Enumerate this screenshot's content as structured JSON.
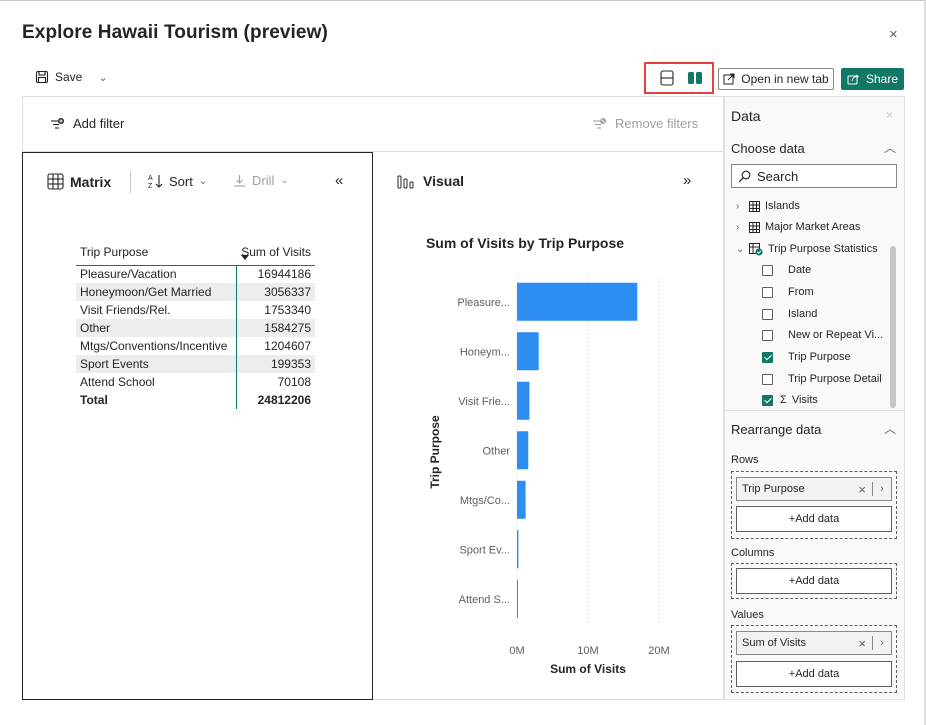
{
  "dialog": {
    "title": "Explore Hawaii Tourism (preview)",
    "close_glyph": "×"
  },
  "toolbar": {
    "save_label": "Save",
    "open_new_tab_label": "Open in new tab",
    "share_label": "Share"
  },
  "filters": {
    "add_filter_label": "Add filter",
    "remove_filters_label": "Remove filters"
  },
  "matrix": {
    "title": "Matrix",
    "sort_label": "Sort",
    "drill_label": "Drill",
    "columns": [
      "Trip Purpose",
      "Sum of Visits"
    ],
    "rows": [
      {
        "label": "Pleasure/Vacation",
        "value": "16944186"
      },
      {
        "label": "Honeymoon/Get Married",
        "value": "3056337"
      },
      {
        "label": "Visit Friends/Rel.",
        "value": "1753340"
      },
      {
        "label": "Other",
        "value": "1584275"
      },
      {
        "label": "Mtgs/Conventions/Incentive",
        "value": "1204607"
      },
      {
        "label": "Sport Events",
        "value": "199353"
      },
      {
        "label": "Attend School",
        "value": "70108"
      }
    ],
    "total": {
      "label": "Total",
      "value": "24812206"
    }
  },
  "visual": {
    "title": "Visual"
  },
  "chart_data": {
    "type": "bar",
    "orientation": "horizontal",
    "title": "Sum of Visits by Trip Purpose",
    "xlabel": "Sum of Visits",
    "ylabel": "Trip Purpose",
    "categories": [
      "Pleasure...",
      "Honeym...",
      "Visit Frie...",
      "Other",
      "Mtgs/Co...",
      "Sport Ev...",
      "Attend S..."
    ],
    "values": [
      16944186,
      3056337,
      1753340,
      1584275,
      1204607,
      199353,
      70108
    ],
    "x_ticks": [
      "0M",
      "10M",
      "20M"
    ],
    "xlim": [
      0,
      20000000
    ],
    "grid": true,
    "bar_color": "#2b8ef0"
  },
  "data_pane": {
    "title": "Data",
    "choose_data_label": "Choose data",
    "search_placeholder": "Search",
    "tables": [
      {
        "name": "Islands",
        "expanded": false
      },
      {
        "name": "Major Market Areas",
        "expanded": false
      },
      {
        "name": "Trip Purpose Statistics",
        "expanded": true
      }
    ],
    "fields": [
      {
        "name": "Date",
        "checked": false
      },
      {
        "name": "From",
        "checked": false
      },
      {
        "name": "Island",
        "checked": false
      },
      {
        "name": "New or Repeat Vi...",
        "checked": false
      },
      {
        "name": "Trip Purpose",
        "checked": true
      },
      {
        "name": "Trip Purpose Detail",
        "checked": false
      },
      {
        "name": "Visits",
        "checked": true,
        "sigma": "Σ"
      }
    ],
    "rearrange_label": "Rearrange data",
    "rows_label": "Rows",
    "rows_value": "Trip Purpose",
    "columns_label": "Columns",
    "values_label": "Values",
    "values_value": "Sum of Visits",
    "add_data_label": "+Add data"
  },
  "colors": {
    "accent": "#117865",
    "highlight_border": "#e8403f"
  }
}
